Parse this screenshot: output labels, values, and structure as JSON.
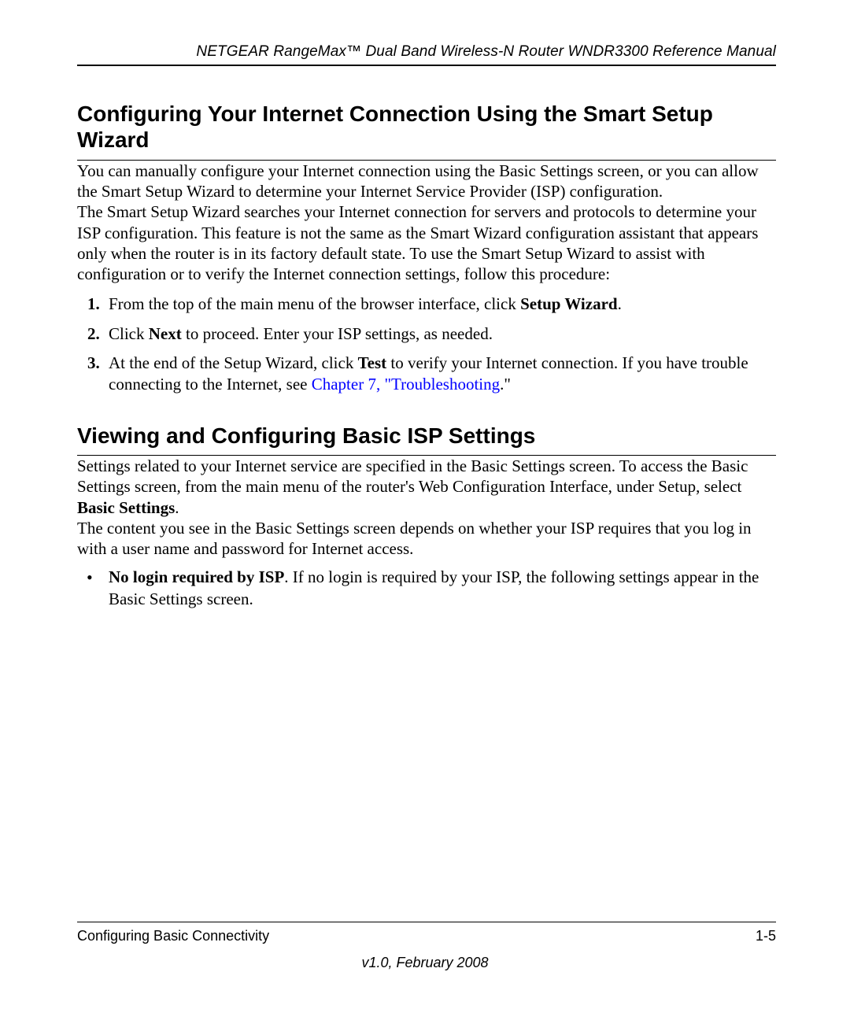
{
  "header": {
    "running_title": "NETGEAR RangeMax™ Dual Band Wireless-N Router WNDR3300 Reference Manual"
  },
  "section1": {
    "title": "Configuring Your Internet Connection Using the Smart Setup Wizard",
    "p1": "You can manually configure your Internet connection using the Basic Settings screen, or you can allow the Smart Setup Wizard to determine your Internet Service Provider (ISP) configuration.",
    "p2": "The Smart Setup Wizard searches your Internet connection for servers and protocols to determine your ISP configuration. This feature is not the same as the Smart Wizard configuration assistant that appears only when the router is in its factory default state. To use the Smart Setup Wizard to assist with configuration or to verify the Internet connection settings, follow this procedure:",
    "steps": {
      "s1_a": "From the top of the main menu of the browser interface, click ",
      "s1_b": "Setup Wizard",
      "s1_c": ".",
      "s2_a": "Click ",
      "s2_b": "Next",
      "s2_c": " to proceed. Enter your ISP settings, as needed.",
      "s3_a": "At the end of the Setup Wizard, click ",
      "s3_b": "Test",
      "s3_c": " to verify your Internet connection. If you have trouble connecting to the Internet, see ",
      "s3_link": "Chapter 7, \"Troubleshooting",
      "s3_d": ".\""
    }
  },
  "section2": {
    "title": "Viewing and Configuring Basic ISP Settings",
    "p1_a": "Settings related to your Internet service are specified in the Basic Settings screen. To access the Basic Settings screen, from the main menu of the router's Web Configuration Interface, under Setup, select ",
    "p1_b": "Basic Settings",
    "p1_c": ".",
    "p2": "The content you see in the Basic Settings screen depends on whether your ISP requires that you log in with a user name and password for Internet access.",
    "bullet1_a": "No login required by ISP",
    "bullet1_b": ". If no login is required by your ISP, the following settings appear in the Basic Settings screen."
  },
  "footer": {
    "left": "Configuring Basic Connectivity",
    "right": "1-5",
    "version": "v1.0, February 2008"
  }
}
